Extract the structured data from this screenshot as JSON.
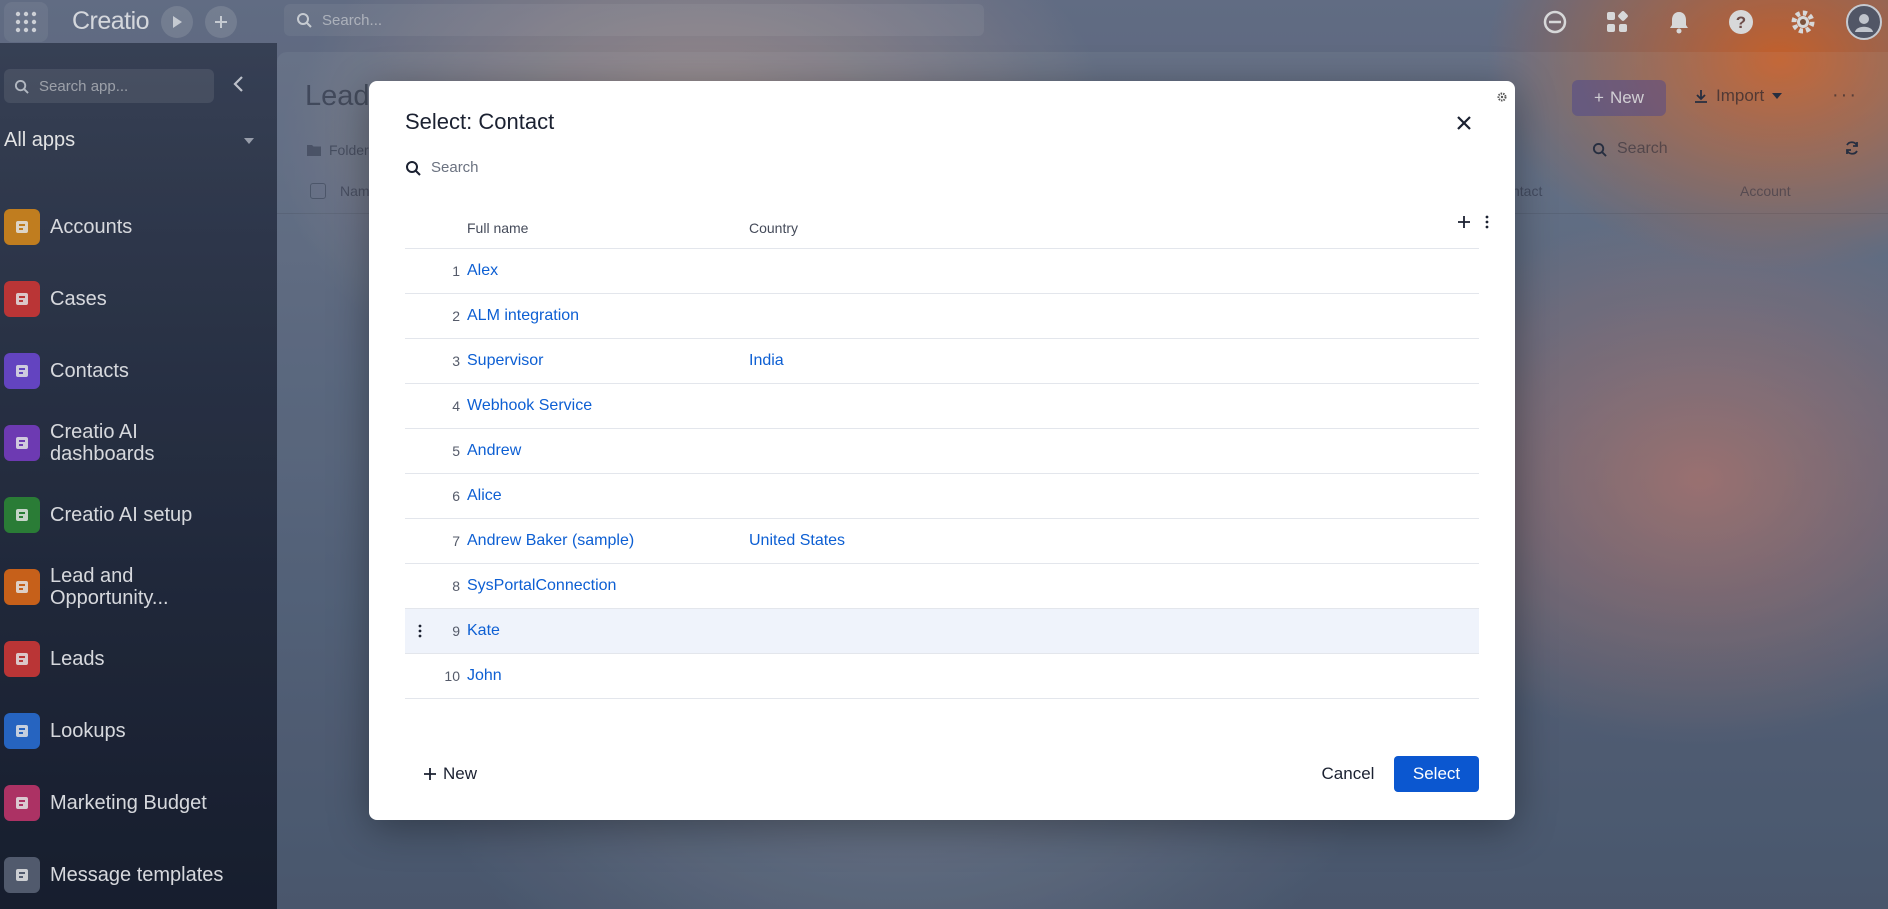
{
  "topbar": {
    "logo": "Creatio",
    "search_placeholder": "Search..."
  },
  "sidebar": {
    "search_placeholder": "Search app...",
    "all_apps_label": "All apps",
    "items": [
      {
        "label": "Accounts",
        "icon": "accounts-icon",
        "color": "#d98b1f"
      },
      {
        "label": "Cases",
        "icon": "cases-icon",
        "color": "#d23a3a"
      },
      {
        "label": "Contacts",
        "icon": "contacts-icon",
        "color": "#6f4bd6"
      },
      {
        "label": "Creatio AI dashboards",
        "icon": "ai-dashboards-icon",
        "color": "#7a3fc6"
      },
      {
        "label": "Creatio AI setup",
        "icon": "ai-setup-icon",
        "color": "#2e8a3a"
      },
      {
        "label": "Lead and Opportunity...",
        "icon": "lead-opportunity-icon",
        "color": "#e06a1a"
      },
      {
        "label": "Leads",
        "icon": "leads-icon",
        "color": "#d23a3a"
      },
      {
        "label": "Lookups",
        "icon": "lookups-icon",
        "color": "#2a6fd6"
      },
      {
        "label": "Marketing Budget",
        "icon": "marketing-budget-icon",
        "color": "#c2366e"
      },
      {
        "label": "Message templates",
        "icon": "message-templates-icon",
        "color": "#5a6478"
      }
    ]
  },
  "background_page": {
    "title": "Lead",
    "folders_label": "Folder",
    "new_label": "New",
    "import_label": "Import",
    "search_placeholder": "Search",
    "col_name": "Nam",
    "col_contact": "ntact",
    "col_account": "Account"
  },
  "modal": {
    "title": "Select: Contact",
    "search_placeholder": "Search",
    "columns": {
      "full_name": "Full name",
      "country": "Country"
    },
    "rows": [
      {
        "num": "1",
        "name": "Alex",
        "country": ""
      },
      {
        "num": "2",
        "name": "ALM integration",
        "country": ""
      },
      {
        "num": "3",
        "name": "Supervisor",
        "country": "India"
      },
      {
        "num": "4",
        "name": "Webhook Service",
        "country": ""
      },
      {
        "num": "5",
        "name": "Andrew",
        "country": ""
      },
      {
        "num": "6",
        "name": "Alice",
        "country": ""
      },
      {
        "num": "7",
        "name": "Andrew Baker (sample)",
        "country": "United States"
      },
      {
        "num": "8",
        "name": "SysPortalConnection",
        "country": ""
      },
      {
        "num": "9",
        "name": "Kate",
        "country": ""
      },
      {
        "num": "10",
        "name": "John",
        "country": ""
      }
    ],
    "new_label": "New",
    "cancel_label": "Cancel",
    "select_label": "Select",
    "accent_color": "#0b57d0",
    "link_color": "#0d5fd3"
  }
}
